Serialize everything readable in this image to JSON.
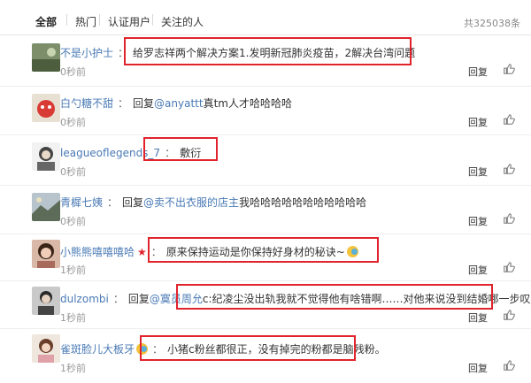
{
  "tabs": {
    "all": "全部",
    "hot": "热门",
    "verified": "认证用户",
    "following": "关注的人",
    "total": "共325038条"
  },
  "comments": [
    {
      "user": "不是小护士",
      "text": "给罗志祥两个解决方案1.发明新冠肺炎疫苗，2解决台湾问题",
      "time": "0秒前",
      "reply": "回复"
    },
    {
      "user": "白勺糖不甜",
      "prefix": "回复",
      "at": "@anyattt",
      "text": "真tm人才哈哈哈哈",
      "time": "0秒前",
      "reply": "回复"
    },
    {
      "user": "leagueoflegends_7",
      "text": "敷衍",
      "time": "0秒前",
      "reply": "回复"
    },
    {
      "user": "青樨七姨",
      "prefix": "回复",
      "at": "@卖不出衣服的店主",
      "text": "我哈哈哈哈哈哈哈哈哈哈哈",
      "time": "0秒前",
      "reply": "回复"
    },
    {
      "user": "小熊熊嘻嘻嘻哈",
      "text": "原来保持运动是你保持好身材的秘诀~",
      "time": "1秒前",
      "reply": "回复",
      "badge": "★"
    },
    {
      "user": "dulzombi",
      "prefix": "回复",
      "at": "@寞员周允",
      "text": "c:纪凌尘没出轨我就不觉得他有啥错啊……对他来说没到结婚哪一步叹",
      "time": "1秒前",
      "reply": "回复"
    },
    {
      "user": "雀斑脸儿大板牙",
      "text": "小猪c粉丝都很正，没有掉完的粉都是脑残粉。",
      "time": "1秒前",
      "reply": "回复"
    }
  ],
  "icons": {
    "like": "thumbs-up-icon",
    "badge": "star-icon",
    "emoji": "smiley-emoji-icon"
  },
  "colors": {
    "username": "#4a7ab5",
    "highlight": "#e0232c",
    "time": "#999999"
  }
}
